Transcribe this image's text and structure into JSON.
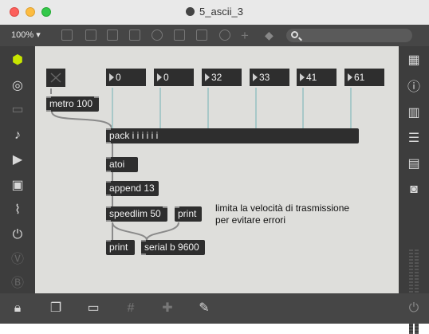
{
  "window": {
    "title": "5_ascii_3"
  },
  "toolbar": {
    "zoom": "100%",
    "zoom_arrow": "▾",
    "icons": [
      "presentation-icon",
      "message-icon",
      "comment-icon",
      "toggle-icon",
      "button-icon",
      "play-icon",
      "slider-icon",
      "dial-icon",
      "add-icon",
      "paint-bucket-icon"
    ],
    "search_placeholder": ""
  },
  "left_sidebar": [
    "cube-icon",
    "target-icon",
    "film-icon",
    "music-note-icon",
    "play-step-icon",
    "image-icon",
    "paperclip-icon",
    "plug-icon",
    "vizzie-v-icon",
    "vizzie-b-icon"
  ],
  "right_sidebar": [
    "grid-icon",
    "info-icon",
    "book-open-icon",
    "list-icon",
    "reference-icon",
    "camera-icon"
  ],
  "bottom_bar": [
    "lock-icon",
    "windows-icon",
    "presentation-icon",
    "grid-icon",
    "add-object-icon",
    "wrench-icon",
    "power-icon"
  ],
  "patch": {
    "toggle": {
      "label": "×"
    },
    "metro": {
      "text": "metro 100"
    },
    "numbers": [
      "0",
      "0",
      "32",
      "33",
      "41",
      "61"
    ],
    "pack": {
      "text": "pack i i i i i i"
    },
    "atoi": {
      "text": "atoi"
    },
    "append": {
      "text": "append 13"
    },
    "speedlim": {
      "text": "speedlim 50"
    },
    "print_top": {
      "text": "print"
    },
    "print_bottom": {
      "text": "print"
    },
    "serial": {
      "text": "serial b 9600"
    },
    "comment": {
      "text": "limita la velocità di trasmissione per evitare errori"
    }
  },
  "colors": {
    "canvas": "#dededb",
    "object": "#2e2e2e",
    "wire": "#8a8a8a",
    "wire_int": "#a8c8c8",
    "sidebar": "#3d3d3d",
    "cube_accent": "#c8e600"
  }
}
